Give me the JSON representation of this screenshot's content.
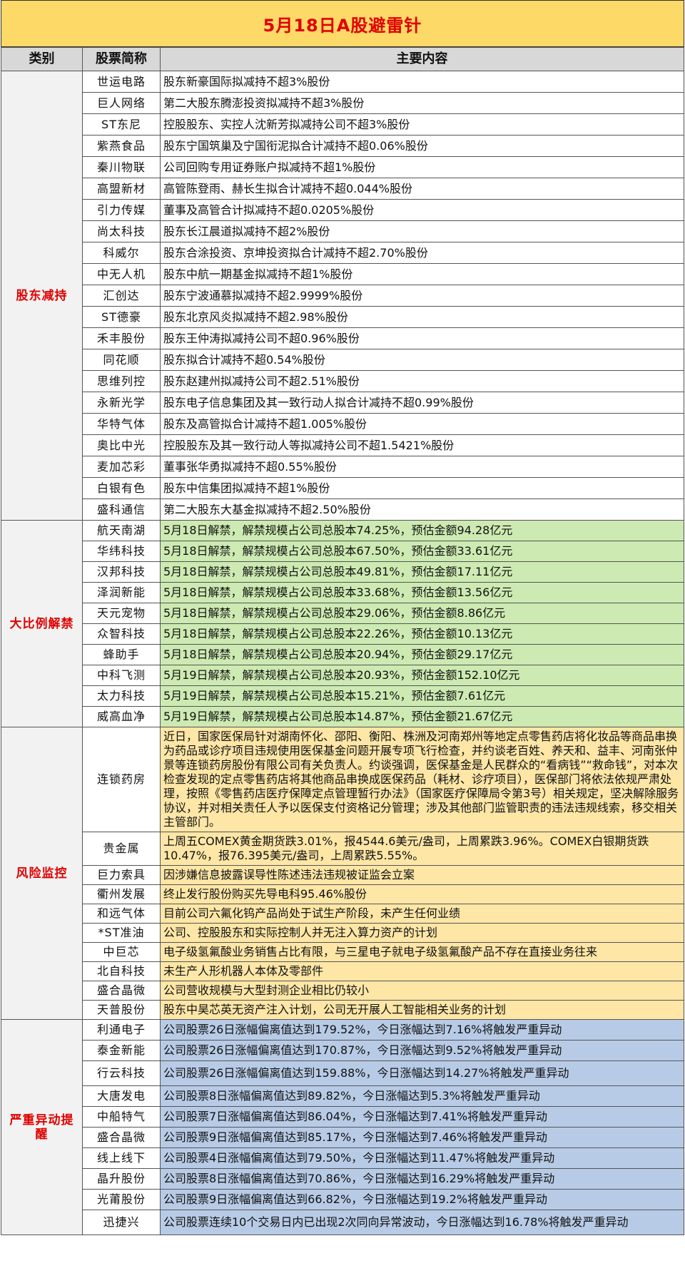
{
  "title": "5月18日A股避雷针",
  "headers": {
    "category": "类别",
    "stock": "股票简称",
    "content": "主要内容"
  },
  "sections": [
    {
      "category": "股东减持",
      "style": "r1",
      "rows": [
        {
          "name": "世运电路",
          "content": "股东新豪国际拟减持不超3%股份"
        },
        {
          "name": "巨人网络",
          "content": "第二大股东腾澎投资拟减持不超3%股份"
        },
        {
          "name": "ST东尼",
          "content": "控股股东、实控人沈新芳拟减持公司不超3%股份"
        },
        {
          "name": "紫燕食品",
          "content": "股东宁国筑巢及宁国衔泥拟合计减持不超0.06%股份"
        },
        {
          "name": "秦川物联",
          "content": "公司回购专用证券账户拟减持不超1%股份"
        },
        {
          "name": "高盟新材",
          "content": "高管陈登雨、赫长生拟合计减持不超0.044%股份"
        },
        {
          "name": "引力传媒",
          "content": "董事及高管合计拟减持不超0.0205%股份"
        },
        {
          "name": "尚太科技",
          "content": "股东长江晨道拟减持不超2%股份"
        },
        {
          "name": "科威尔",
          "content": "股东合涂投资、京坤投资拟合计减持不超2.70%股份"
        },
        {
          "name": "中无人机",
          "content": "股东中航一期基金拟减持不超1%股份"
        },
        {
          "name": "汇创达",
          "content": "股东宁波通慕拟减持不超2.9999%股份"
        },
        {
          "name": "ST德豪",
          "content": "股东北京风炎拟减持不超2.98%股份"
        },
        {
          "name": "禾丰股份",
          "content": "股东王仲涛拟减持公司不超0.96%股份"
        },
        {
          "name": "同花顺",
          "content": "股东拟合计减持不超0.54%股份"
        },
        {
          "name": "思维列控",
          "content": "股东赵建州拟减持公司不超2.51%股份"
        },
        {
          "name": "永新光学",
          "content": "股东电子信息集团及其一致行动人拟合计减持不超0.99%股份"
        },
        {
          "name": "华特气体",
          "content": "股东及高管拟合计减持不超1.005%股份"
        },
        {
          "name": "奥比中光",
          "content": "控股股东及其一致行动人等拟减持公司不超1.5421%股份"
        },
        {
          "name": "麦加芯彩",
          "content": "董事张华勇拟减持不超0.55%股份"
        },
        {
          "name": "白银有色",
          "content": "股东中信集团拟减持不超1%股份"
        },
        {
          "name": "盛科通信",
          "content": "第二大股东大基金拟减持不超2.50%股份"
        }
      ]
    },
    {
      "category": "大比例解禁",
      "style": "r2",
      "rows": [
        {
          "name": "航天南湖",
          "content": "5月18日解禁，解禁规模占公司总股本74.25%，预估金额94.28亿元"
        },
        {
          "name": "华纬科技",
          "content": "5月18日解禁，解禁规模占公司总股本67.50%，预估金额33.61亿元"
        },
        {
          "name": "汉邦科技",
          "content": "5月18日解禁，解禁规模占公司总股本49.81%，预估金额17.11亿元"
        },
        {
          "name": "泽润新能",
          "content": "5月18日解禁，解禁规模占公司总股本33.68%，预估金额13.56亿元"
        },
        {
          "name": "天元宠物",
          "content": "5月18日解禁，解禁规模占公司总股本29.06%，预估金额8.86亿元"
        },
        {
          "name": "众智科技",
          "content": "5月18日解禁，解禁规模占公司总股本22.26%，预估金额10.13亿元"
        },
        {
          "name": "蜂助手",
          "content": "5月18日解禁，解禁规模占公司总股本20.94%，预估金额29.17亿元"
        },
        {
          "name": "中科飞测",
          "content": "5月19日解禁，解禁规模占公司总股本20.93%，预估金额152.10亿元"
        },
        {
          "name": "太力科技",
          "content": "5月19日解禁，解禁规模占公司总股本15.21%，预估金额7.61亿元"
        },
        {
          "name": "威高血净",
          "content": "5月19日解禁，解禁规模占公司总股本14.87%，预估金额21.67亿元"
        }
      ]
    },
    {
      "category": "风险监控",
      "style": "r3",
      "rows": [
        {
          "name": "连锁药房",
          "content": "近日，国家医保局针对湖南怀化、邵阳、衡阳、株洲及河南郑州等地定点零售药店将化妆品等商品串换为药品或诊疗项目违规使用医保基金问题开展专项飞行检查，并约谈老百姓、养天和、益丰、河南张仲景等连锁药房股份有限公司有关负责人。约谈强调，医保基金是人民群众的“看病钱”“救命钱”，对本次检查发现的定点零售药店将其他商品串换成医保药品（耗材、诊疗项目），医保部门将依法依规严肃处理，按照《零售药店医疗保障定点管理暂行办法》（国家医疗保障局令第3号）相关规定，坚决解除服务协议，并对相关责任人予以医保支付资格记分管理；涉及其他部门监管职责的违法违规线索，移交相关主管部门。"
        },
        {
          "name": "贵金属",
          "content": "上周五COMEX黄金期货跌3.01%，报4544.6美元/盎司，上周累跌3.96%。COMEX白银期货跌10.47%，报76.395美元/盎司，上周累跌5.55%。"
        },
        {
          "name": "巨力索具",
          "content": "因涉嫌信息披露误导性陈述违法违规被证监会立案"
        },
        {
          "name": "衢州发展",
          "content": "终止发行股份购买先导电科95.46%股份"
        },
        {
          "name": "和远气体",
          "content": "目前公司六氟化钨产品尚处于试生产阶段，未产生任何业绩"
        },
        {
          "name": "*ST准油",
          "content": "公司、控股股东和实际控制人并无注入算力资产的计划"
        },
        {
          "name": "中巨芯",
          "content": "电子级氢氟酸业务销售占比有限，与三星电子就电子级氢氟酸产品不存在直接业务往来"
        },
        {
          "name": "北自科技",
          "content": "未生产人形机器人本体及零部件"
        },
        {
          "name": "盛合晶微",
          "content": "公司营收规模与大型封测企业相比仍较小"
        },
        {
          "name": "天普股份",
          "content": "股东中昊芯英无资产注入计划，公司无开展人工智能相关业务的计划"
        }
      ]
    },
    {
      "category": "严重异动提醒",
      "style": "r4",
      "rows": [
        {
          "name": "利通电子",
          "content": "公司股票26日涨幅偏离值达到179.52%，今日涨幅达到7.16%将触发严重异动"
        },
        {
          "name": "泰金新能",
          "content": "公司股票26日涨幅偏离值达到170.87%，今日涨幅达到9.52%将触发严重异动"
        },
        {
          "name": "行云科技",
          "content": "公司股票26日涨幅偏离值达到159.88%，今日涨幅达到14.27%将触发严重异动"
        },
        {
          "name": "大唐发电",
          "content": "公司股票8日涨幅偏离值达到89.82%，今日涨幅达到5.3%将触发严重异动"
        },
        {
          "name": "中船特气",
          "content": "公司股票7日涨幅偏离值达到86.04%，今日涨幅达到7.41%将触发严重异动"
        },
        {
          "name": "盛合晶微",
          "content": "公司股票9日涨幅偏离值达到85.17%，今日涨幅达到7.46%将触发严重异动"
        },
        {
          "name": "线上线下",
          "content": "公司股票4日涨幅偏离值达到79.50%，今日涨幅达到11.47%将触发严重异动"
        },
        {
          "name": "晶升股份",
          "content": "公司股票8日涨幅偏离值达到70.86%，今日涨幅达到16.29%将触发严重异动"
        },
        {
          "name": "光莆股份",
          "content": "公司股票9日涨幅偏离值达到66.82%，今日涨幅达到19.2%将触发严重异动"
        },
        {
          "name": "迅捷兴",
          "content": "公司股票连续10个交易日内已出现2次同向异常波动，今日涨幅达到16.78%将触发严重异动"
        }
      ]
    }
  ],
  "colors": {
    "title_bg": "#fdd967",
    "title_text": "#e10000",
    "unlock_bg": "#cdeab2",
    "risk_bg": "#fde6a6",
    "alert_bg": "#b8cbe6"
  }
}
